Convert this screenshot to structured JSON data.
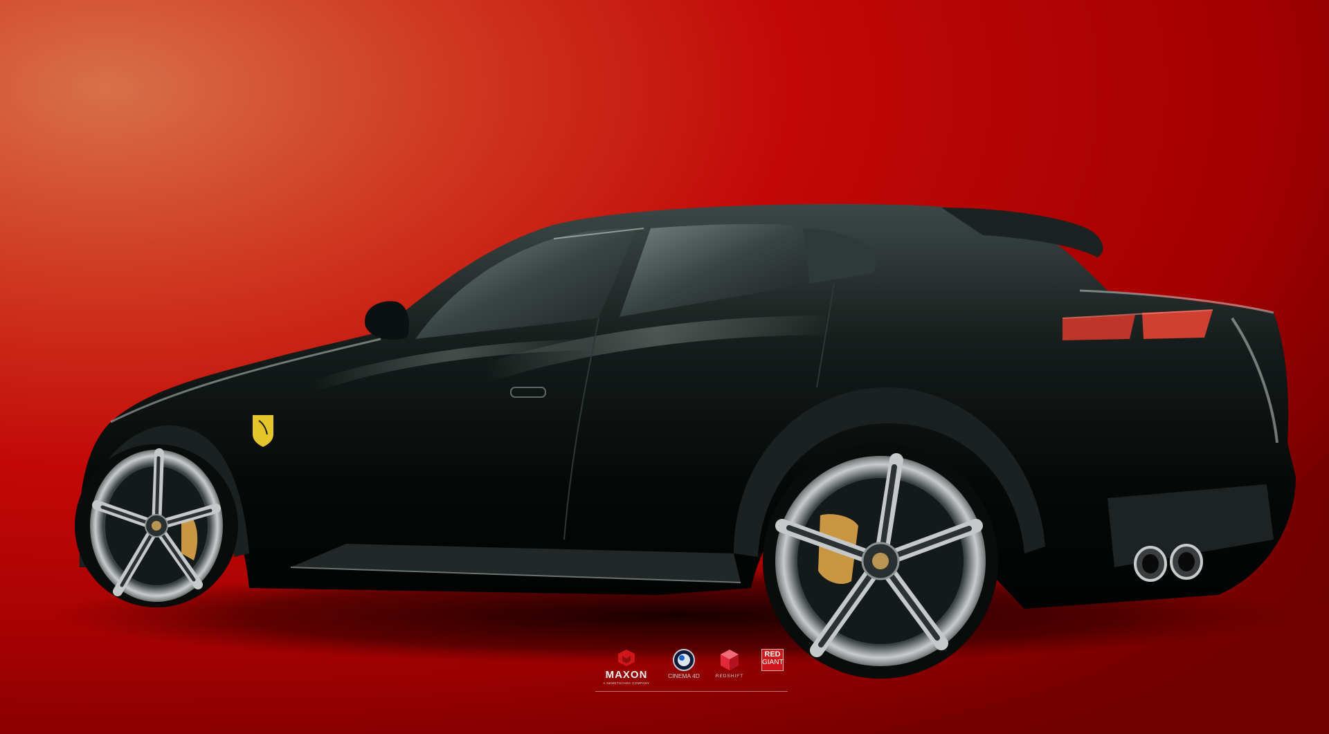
{
  "image": {
    "subject": "black SUV studio render",
    "colors": {
      "background_light": "#d2603f",
      "background_mid": "#c00808",
      "background_dark": "#6c0000",
      "car_body": "#0d1211",
      "accent_badge": "#e6c42c",
      "brake_caliper": "#c99644"
    }
  },
  "logos": {
    "maxon": {
      "name": "MAXON",
      "tagline": "A NEMETSCHEK COMPANY",
      "icon": "maxon-cube-icon"
    },
    "cinema4d": {
      "name": "CINEMA 4D",
      "icon": "cinema4d-sphere-icon"
    },
    "redshift": {
      "name": "REDSHIFT",
      "icon": "redshift-cube-icon"
    },
    "redgiant": {
      "line1": "RED",
      "line2": "GIANT",
      "icon": "redgiant-square-icon"
    }
  }
}
